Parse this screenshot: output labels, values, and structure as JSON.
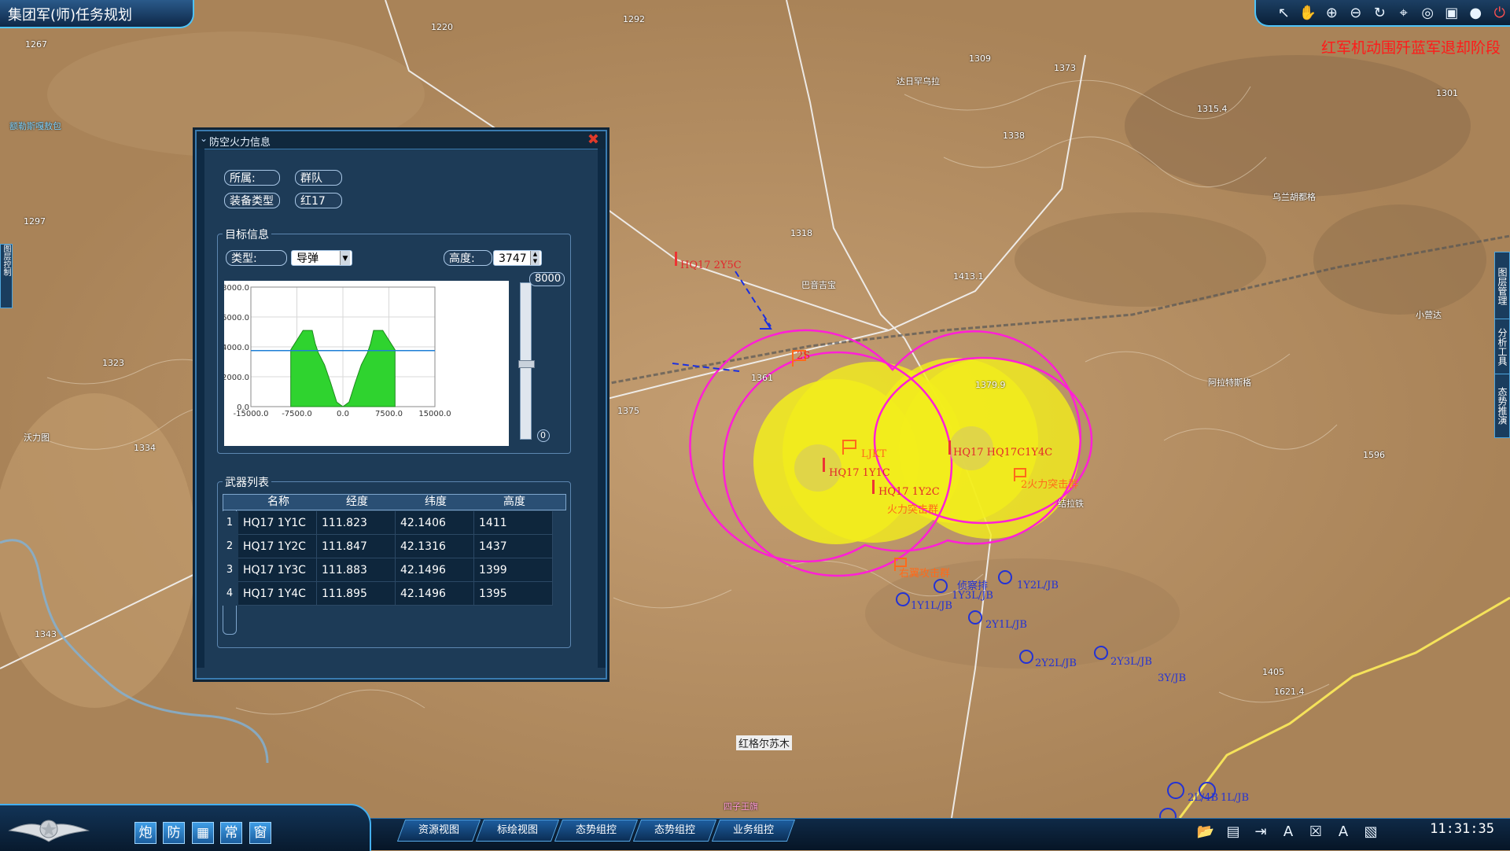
{
  "app": {
    "title": "集团军(师)任务规划"
  },
  "phase_text": "红军机动围歼蓝军退却阶段",
  "toolbar": {
    "icons": [
      "pointer-icon",
      "hand-icon",
      "zoom-in-icon",
      "zoom-out-icon",
      "refresh-icon",
      "measure-icon",
      "globe-icon",
      "window-icon",
      "earth-icon",
      "power-icon"
    ]
  },
  "panel": {
    "title": "防空火力信息",
    "affiliation_label": "所属:",
    "affiliation_value": "群队",
    "equip_label": "装备类型",
    "equip_value": "红17",
    "target_group_title": "目标信息",
    "type_label": "类型:",
    "type_value": "导弹",
    "height_label": "高度:",
    "height_value": "3747",
    "slider_max": "8000",
    "slider_min": "0",
    "weapon_group_title": "武器列表",
    "table": {
      "headers": [
        "名称",
        "经度",
        "纬度",
        "高度"
      ],
      "rows": [
        {
          "idx": "1",
          "name": "HQ17 1Y1C",
          "lon": "111.823",
          "lat": "42.1406",
          "alt": "1411"
        },
        {
          "idx": "2",
          "name": "HQ17 1Y2C",
          "lon": "111.847",
          "lat": "42.1316",
          "alt": "1437"
        },
        {
          "idx": "3",
          "name": "HQ17 1Y3C",
          "lon": "111.883",
          "lat": "42.1496",
          "alt": "1399"
        },
        {
          "idx": "4",
          "name": "HQ17 1Y4C",
          "lon": "111.895",
          "lat": "42.1496",
          "alt": "1395"
        }
      ]
    }
  },
  "chart_data": {
    "type": "area",
    "title": "",
    "xlabel": "",
    "ylabel": "",
    "xlim": [
      -15000,
      15000
    ],
    "ylim": [
      0,
      8000
    ],
    "x_ticks": [
      "-15000.0",
      "-7500.0",
      "0.0",
      "7500.0",
      "15000.0"
    ],
    "y_ticks": [
      "8000.0",
      "6000.0",
      "4000.0",
      "2000.0",
      "0.0"
    ],
    "horizontal_line": 3747,
    "series": [
      {
        "values_x": [
          -8500,
          -6500,
          -5000,
          -4500,
          -4000,
          -3000,
          -2000,
          -1000,
          0
        ],
        "values_top": [
          3800,
          5100,
          5100,
          4200,
          3600,
          2800,
          1600,
          300,
          0
        ],
        "values_bottom": [
          0,
          0,
          0,
          0,
          0,
          0,
          0,
          0,
          0
        ]
      },
      {
        "values_x": [
          0,
          1000,
          2000,
          3000,
          4000,
          4500,
          5000,
          6500,
          8500
        ],
        "values_top": [
          0,
          300,
          1600,
          2800,
          3600,
          4200,
          5100,
          5100,
          3800
        ],
        "values_bottom": [
          0,
          0,
          0,
          0,
          0,
          0,
          0,
          0,
          0
        ]
      }
    ],
    "colors": {
      "fill": "#2fd32f",
      "line": "#1e7fd6"
    }
  },
  "map": {
    "place_labels": [
      {
        "text": "红格尔苏木"
      },
      {
        "text": "额勒斯嘎敖包"
      },
      {
        "text": "四子王旗"
      },
      {
        "text": "沃力图"
      },
      {
        "text": "巴音吉宝"
      },
      {
        "text": "乌兰胡都格"
      },
      {
        "text": "小营达"
      },
      {
        "text": "阿拉特斯格"
      },
      {
        "text": "结拉铁"
      },
      {
        "text": "达日罕乌拉"
      }
    ],
    "unit_labels": [
      {
        "text": "HQ17 2Y5C"
      },
      {
        "text": "2S"
      },
      {
        "text": "HQ17 1Y1C"
      },
      {
        "text": "LJKT"
      },
      {
        "text": "HQ17 1Y2C"
      },
      {
        "text": "HQ17 HQ17C1Y4C"
      },
      {
        "text": "火力突击群"
      },
      {
        "text": "2火力突击群"
      },
      {
        "text": "右翼攻击群"
      },
      {
        "text": "侦察排"
      },
      {
        "text": "1Y3L/JB"
      },
      {
        "text": "1Y1L/JB"
      },
      {
        "text": "1Y2L/JB"
      },
      {
        "text": "2Y1L/JB"
      },
      {
        "text": "2Y2L/JB"
      },
      {
        "text": "2Y3L/JB"
      },
      {
        "text": "3Y/JB"
      },
      {
        "text": "2L/4B"
      },
      {
        "text": "1L/JB"
      }
    ],
    "elevations": [
      "1315.4",
      "1301",
      "1413.1",
      "1379.9",
      "1596",
      "1621.4",
      "1338",
      "1318",
      "1361",
      "1375",
      "1323",
      "1334",
      "1297",
      "1267",
      "1343",
      "1292",
      "1220",
      "1309",
      "1373",
      "1405"
    ],
    "range_colors": {
      "fill": "#f2ee1c",
      "border": "#ff1fd6"
    }
  },
  "bottom": {
    "left_buttons": [
      "炮",
      "防",
      "",
      "常",
      "窗"
    ],
    "tabs": [
      "资源视图",
      "标绘视图",
      "态势组控",
      "态势组控",
      "业务组控"
    ],
    "clock": "11:31:35",
    "right_icons": [
      "folder-open-icon",
      "save-icon",
      "export-icon",
      "text-a-icon",
      "close-doc-icon",
      "text-b-icon",
      "layers-icon"
    ]
  },
  "side_tabs": [
    "图层管理",
    "分析工具",
    "态势推演"
  ],
  "left_tab": "图层控制"
}
